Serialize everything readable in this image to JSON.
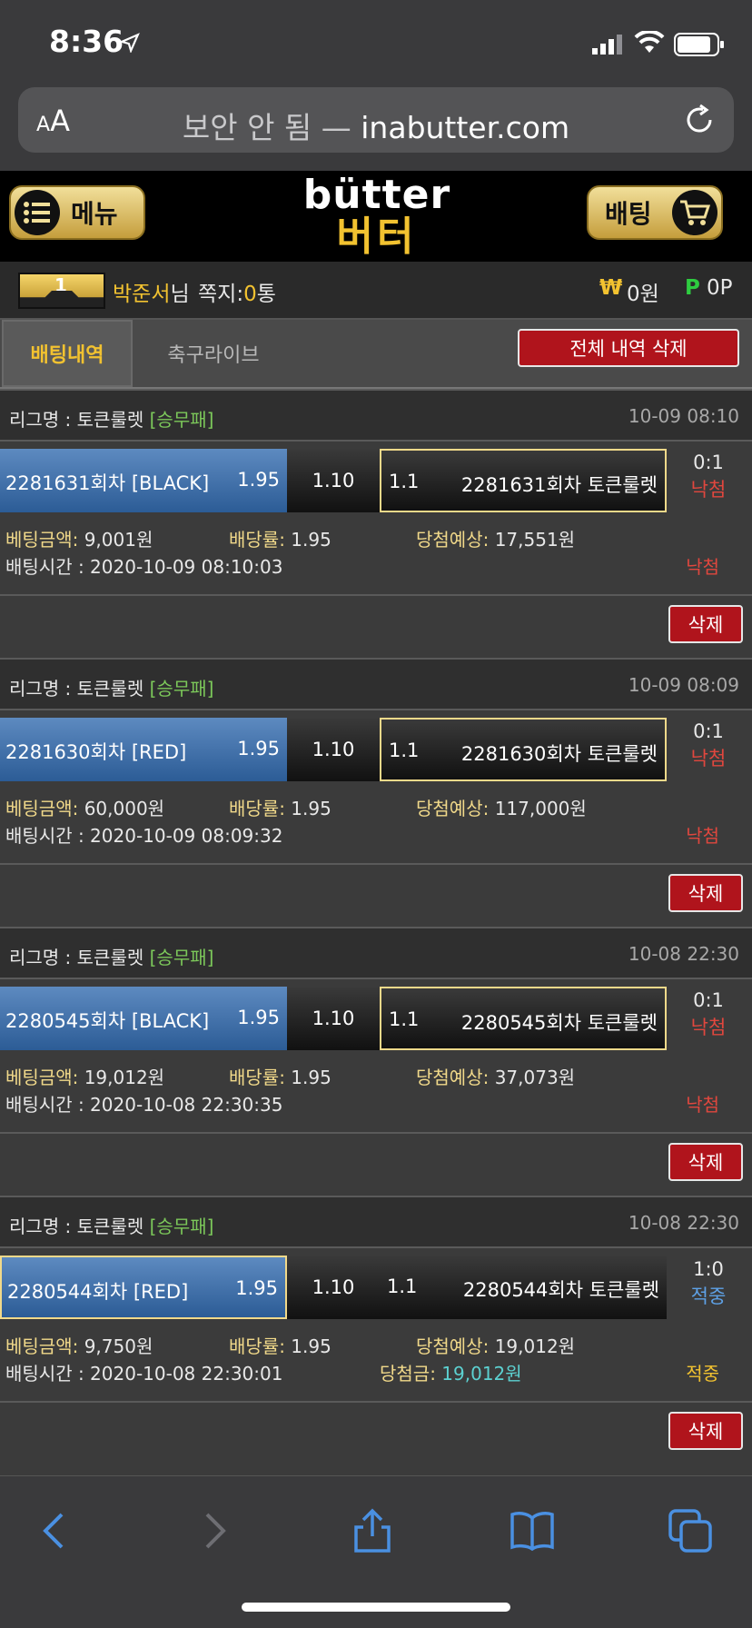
{
  "status_bar": {
    "time": "8:36"
  },
  "browser": {
    "aa_small": "A",
    "aa_big": "A",
    "secure_label": "보안 안 됨 — ",
    "domain": "inabutter.com"
  },
  "header": {
    "menu_label": "메뉴",
    "logo_en": "bütter",
    "logo_ko": "버터",
    "bet_label": "배팅"
  },
  "user": {
    "level": "1",
    "name": "박준서",
    "suffix": "님",
    "msg_label": "쪽지:",
    "msg_count": "0",
    "msg_unit": "통",
    "won_symbol": "₩",
    "won_value": "0원",
    "p_symbol": "P",
    "p_value": "0P"
  },
  "tabs": {
    "active": "배팅내역",
    "inactive": "축구라이브",
    "delete_all": "전체 내역 삭제"
  },
  "cards": [
    {
      "league_label": "리그명 : 토큰룰렛 ",
      "league_tag": "[승무패]",
      "time": "10-09 08:10",
      "home_team": "2281631회차 [BLACK]",
      "home_odds": "1.95",
      "draw_odds": "1.10",
      "away_odds": "1.1",
      "away_team": "2281631회차 토큰룰렛",
      "score": "0:1",
      "score_result": "낙첨",
      "bet_amount_label": "베팅금액:",
      "bet_amount": " 9,001원",
      "odds_label": "배당률:",
      "odds": " 1.95",
      "expected_label": "당첨예상:",
      "expected": " 17,551원",
      "bet_time": "배팅시간 : 2020-10-09 08:10:03",
      "final": "낙첨",
      "delete": "삭제"
    },
    {
      "league_label": "리그명 : 토큰룰렛 ",
      "league_tag": "[승무패]",
      "time": "10-09 08:09",
      "home_team": "2281630회차 [RED]",
      "home_odds": "1.95",
      "draw_odds": "1.10",
      "away_odds": "1.1",
      "away_team": "2281630회차 토큰룰렛",
      "score": "0:1",
      "score_result": "낙첨",
      "bet_amount_label": "베팅금액:",
      "bet_amount": " 60,000원",
      "odds_label": "배당률:",
      "odds": " 1.95",
      "expected_label": "당첨예상:",
      "expected": " 117,000원",
      "bet_time": "배팅시간 : 2020-10-09 08:09:32",
      "final": "낙첨",
      "delete": "삭제"
    },
    {
      "league_label": "리그명 : 토큰룰렛 ",
      "league_tag": "[승무패]",
      "time": "10-08 22:30",
      "home_team": "2280545회차 [BLACK]",
      "home_odds": "1.95",
      "draw_odds": "1.10",
      "away_odds": "1.1",
      "away_team": "2280545회차 토큰룰렛",
      "score": "0:1",
      "score_result": "낙첨",
      "bet_amount_label": "베팅금액:",
      "bet_amount": " 19,012원",
      "odds_label": "배당률:",
      "odds": " 1.95",
      "expected_label": "당첨예상:",
      "expected": " 37,073원",
      "bet_time": "배팅시간 : 2020-10-08 22:30:35",
      "final": "낙첨",
      "delete": "삭제"
    },
    {
      "league_label": "리그명 : 토큰룰렛 ",
      "league_tag": "[승무패]",
      "time": "10-08 22:30",
      "home_team": "2280544회차 [RED]",
      "home_odds": "1.95",
      "draw_odds": "1.10",
      "away_odds": "1.1",
      "away_team": "2280544회차 토큰룰렛",
      "score": "1:0",
      "score_result": "적중",
      "bet_amount_label": "베팅금액:",
      "bet_amount": " 9,750원",
      "odds_label": "배당률:",
      "odds": " 1.95",
      "expected_label": "당첨예상:",
      "expected": " 19,012원",
      "bet_time": "배팅시간 : 2020-10-08 22:30:01",
      "paid_label": "당첨금: ",
      "paid": "19,012원",
      "final": "적중",
      "delete": "삭제"
    }
  ],
  "colors": {
    "accent_gold": "#f2c230",
    "lose_red": "#e0473e",
    "win_blue": "#5ea1e6",
    "delete_red": "#b0141c",
    "league_green": "#7cc85a"
  }
}
